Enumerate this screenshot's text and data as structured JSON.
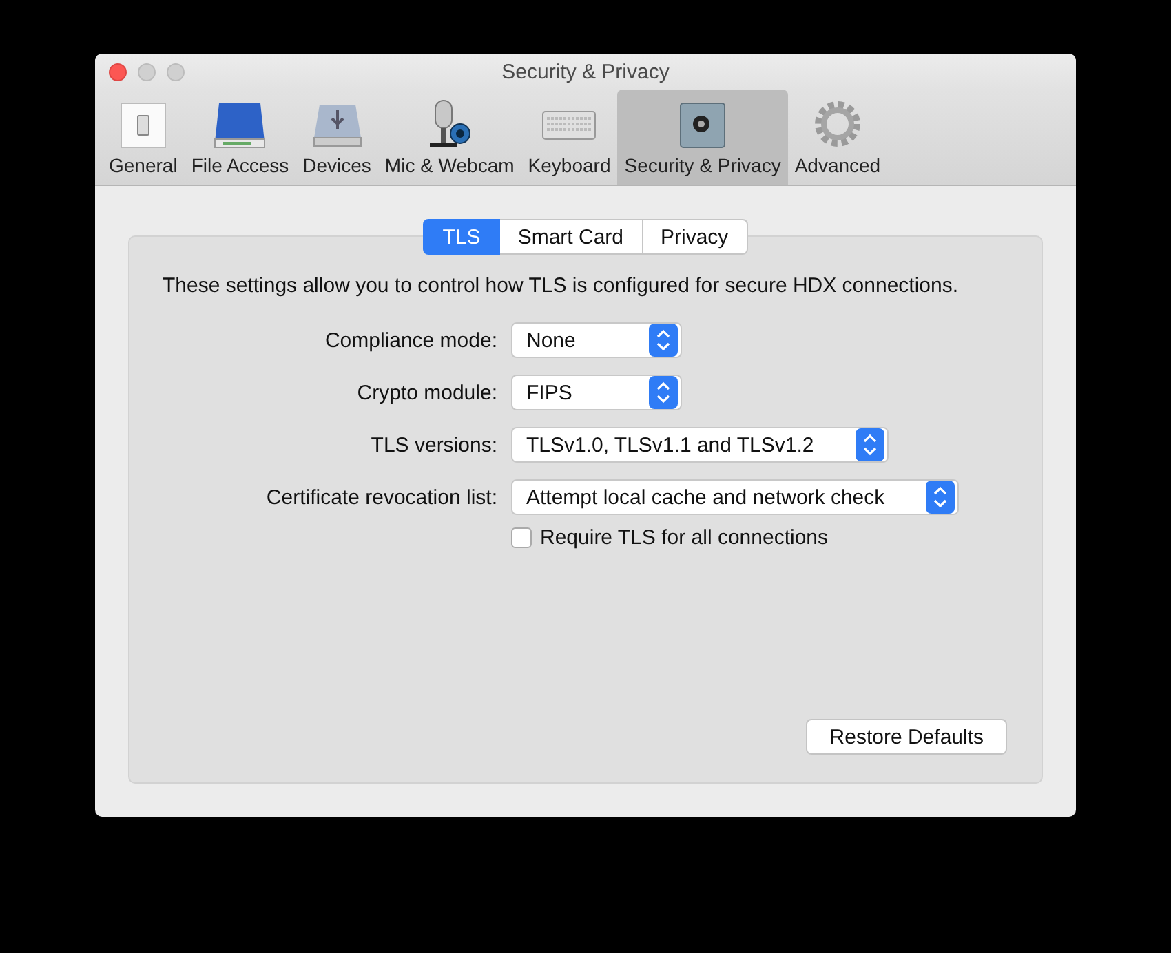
{
  "window": {
    "title": "Security & Privacy"
  },
  "toolbar": [
    {
      "label": "General",
      "selected": false
    },
    {
      "label": "File Access",
      "selected": false
    },
    {
      "label": "Devices",
      "selected": false
    },
    {
      "label": "Mic & Webcam",
      "selected": false
    },
    {
      "label": "Keyboard",
      "selected": false
    },
    {
      "label": "Security & Privacy",
      "selected": true
    },
    {
      "label": "Advanced",
      "selected": false
    }
  ],
  "tabs": [
    {
      "label": "TLS",
      "selected": true
    },
    {
      "label": "Smart Card",
      "selected": false
    },
    {
      "label": "Privacy",
      "selected": false
    }
  ],
  "description": "These settings allow you to control how TLS is configured for secure HDX connections.",
  "fields": [
    {
      "label": "Compliance mode:",
      "value": "None"
    },
    {
      "label": "Crypto module:",
      "value": "FIPS"
    },
    {
      "label": "TLS versions:",
      "value": "TLSv1.0, TLSv1.1 and TLSv1.2"
    },
    {
      "label": "Certificate revocation list:",
      "value": "Attempt local cache and network check"
    }
  ],
  "checkbox": {
    "label": "Require TLS for all connections",
    "checked": false
  },
  "buttons": [
    "Restore Defaults"
  ]
}
